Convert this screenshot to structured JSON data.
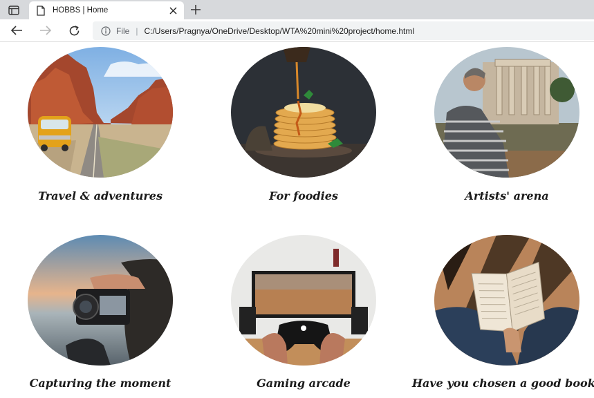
{
  "browser": {
    "tab": {
      "title": "HOBBS | Home"
    },
    "address": {
      "scheme_label": "File",
      "url": "C:/Users/Pragnya/OneDrive/Desktop/WTA%20mini%20project/home.html"
    },
    "icons": {
      "window_menu": "window-icon",
      "tab_doc": "document-icon",
      "tab_close": "close-icon",
      "new_tab": "plus-icon",
      "back": "back-arrow-icon",
      "forward": "forward-arrow-icon",
      "reload": "reload-icon",
      "site_info": "info-icon"
    }
  },
  "categories": [
    {
      "caption": "Travel & adventures",
      "image": "desert road with yellow van"
    },
    {
      "caption": "For foodies",
      "image": "stack of pancakes with syrup"
    },
    {
      "caption": "Artists' arena",
      "image": "man painting ancient ruins"
    },
    {
      "caption": "Capturing the moment",
      "image": "hand holding camera at sunset"
    },
    {
      "caption": "Gaming arcade",
      "image": "hands holding game controller"
    },
    {
      "caption": "Have you chosen a good book?",
      "image": "open book in hands"
    }
  ]
}
